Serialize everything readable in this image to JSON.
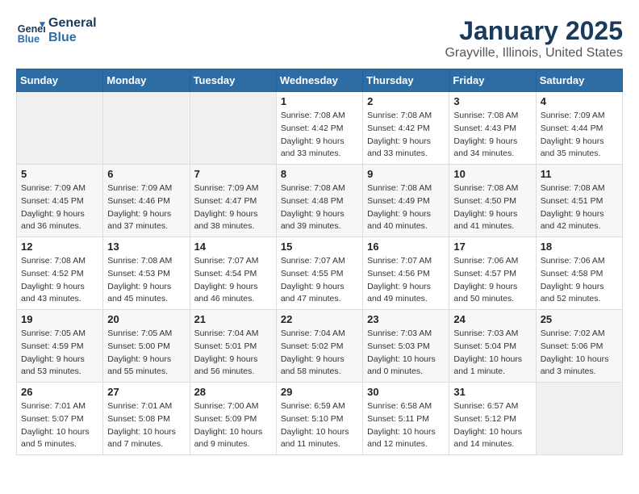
{
  "logo": {
    "line1": "General",
    "line2": "Blue"
  },
  "title": "January 2025",
  "subtitle": "Grayville, Illinois, United States",
  "weekdays": [
    "Sunday",
    "Monday",
    "Tuesday",
    "Wednesday",
    "Thursday",
    "Friday",
    "Saturday"
  ],
  "weeks": [
    [
      {
        "day": "",
        "info": ""
      },
      {
        "day": "",
        "info": ""
      },
      {
        "day": "",
        "info": ""
      },
      {
        "day": "1",
        "info": "Sunrise: 7:08 AM\nSunset: 4:42 PM\nDaylight: 9 hours\nand 33 minutes."
      },
      {
        "day": "2",
        "info": "Sunrise: 7:08 AM\nSunset: 4:42 PM\nDaylight: 9 hours\nand 33 minutes."
      },
      {
        "day": "3",
        "info": "Sunrise: 7:08 AM\nSunset: 4:43 PM\nDaylight: 9 hours\nand 34 minutes."
      },
      {
        "day": "4",
        "info": "Sunrise: 7:09 AM\nSunset: 4:44 PM\nDaylight: 9 hours\nand 35 minutes."
      }
    ],
    [
      {
        "day": "5",
        "info": "Sunrise: 7:09 AM\nSunset: 4:45 PM\nDaylight: 9 hours\nand 36 minutes."
      },
      {
        "day": "6",
        "info": "Sunrise: 7:09 AM\nSunset: 4:46 PM\nDaylight: 9 hours\nand 37 minutes."
      },
      {
        "day": "7",
        "info": "Sunrise: 7:09 AM\nSunset: 4:47 PM\nDaylight: 9 hours\nand 38 minutes."
      },
      {
        "day": "8",
        "info": "Sunrise: 7:08 AM\nSunset: 4:48 PM\nDaylight: 9 hours\nand 39 minutes."
      },
      {
        "day": "9",
        "info": "Sunrise: 7:08 AM\nSunset: 4:49 PM\nDaylight: 9 hours\nand 40 minutes."
      },
      {
        "day": "10",
        "info": "Sunrise: 7:08 AM\nSunset: 4:50 PM\nDaylight: 9 hours\nand 41 minutes."
      },
      {
        "day": "11",
        "info": "Sunrise: 7:08 AM\nSunset: 4:51 PM\nDaylight: 9 hours\nand 42 minutes."
      }
    ],
    [
      {
        "day": "12",
        "info": "Sunrise: 7:08 AM\nSunset: 4:52 PM\nDaylight: 9 hours\nand 43 minutes."
      },
      {
        "day": "13",
        "info": "Sunrise: 7:08 AM\nSunset: 4:53 PM\nDaylight: 9 hours\nand 45 minutes."
      },
      {
        "day": "14",
        "info": "Sunrise: 7:07 AM\nSunset: 4:54 PM\nDaylight: 9 hours\nand 46 minutes."
      },
      {
        "day": "15",
        "info": "Sunrise: 7:07 AM\nSunset: 4:55 PM\nDaylight: 9 hours\nand 47 minutes."
      },
      {
        "day": "16",
        "info": "Sunrise: 7:07 AM\nSunset: 4:56 PM\nDaylight: 9 hours\nand 49 minutes."
      },
      {
        "day": "17",
        "info": "Sunrise: 7:06 AM\nSunset: 4:57 PM\nDaylight: 9 hours\nand 50 minutes."
      },
      {
        "day": "18",
        "info": "Sunrise: 7:06 AM\nSunset: 4:58 PM\nDaylight: 9 hours\nand 52 minutes."
      }
    ],
    [
      {
        "day": "19",
        "info": "Sunrise: 7:05 AM\nSunset: 4:59 PM\nDaylight: 9 hours\nand 53 minutes."
      },
      {
        "day": "20",
        "info": "Sunrise: 7:05 AM\nSunset: 5:00 PM\nDaylight: 9 hours\nand 55 minutes."
      },
      {
        "day": "21",
        "info": "Sunrise: 7:04 AM\nSunset: 5:01 PM\nDaylight: 9 hours\nand 56 minutes."
      },
      {
        "day": "22",
        "info": "Sunrise: 7:04 AM\nSunset: 5:02 PM\nDaylight: 9 hours\nand 58 minutes."
      },
      {
        "day": "23",
        "info": "Sunrise: 7:03 AM\nSunset: 5:03 PM\nDaylight: 10 hours\nand 0 minutes."
      },
      {
        "day": "24",
        "info": "Sunrise: 7:03 AM\nSunset: 5:04 PM\nDaylight: 10 hours\nand 1 minute."
      },
      {
        "day": "25",
        "info": "Sunrise: 7:02 AM\nSunset: 5:06 PM\nDaylight: 10 hours\nand 3 minutes."
      }
    ],
    [
      {
        "day": "26",
        "info": "Sunrise: 7:01 AM\nSunset: 5:07 PM\nDaylight: 10 hours\nand 5 minutes."
      },
      {
        "day": "27",
        "info": "Sunrise: 7:01 AM\nSunset: 5:08 PM\nDaylight: 10 hours\nand 7 minutes."
      },
      {
        "day": "28",
        "info": "Sunrise: 7:00 AM\nSunset: 5:09 PM\nDaylight: 10 hours\nand 9 minutes."
      },
      {
        "day": "29",
        "info": "Sunrise: 6:59 AM\nSunset: 5:10 PM\nDaylight: 10 hours\nand 11 minutes."
      },
      {
        "day": "30",
        "info": "Sunrise: 6:58 AM\nSunset: 5:11 PM\nDaylight: 10 hours\nand 12 minutes."
      },
      {
        "day": "31",
        "info": "Sunrise: 6:57 AM\nSunset: 5:12 PM\nDaylight: 10 hours\nand 14 minutes."
      },
      {
        "day": "",
        "info": ""
      }
    ]
  ]
}
